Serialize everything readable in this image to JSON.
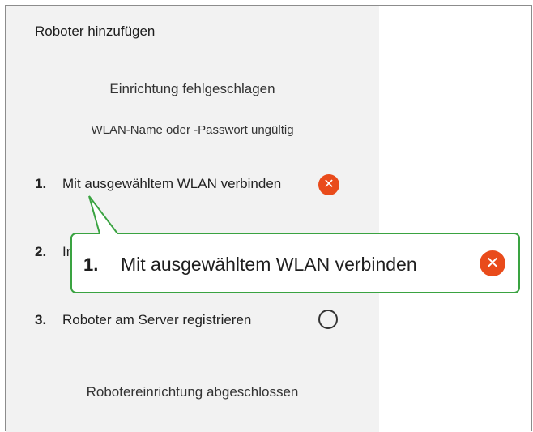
{
  "dialog": {
    "title": "Roboter hinzufügen",
    "status": "Einrichtung fehlgeschlagen",
    "reason": "WLAN-Name oder -Passwort ungültig",
    "completion": "Robotereinrichtung abgeschlossen"
  },
  "steps": [
    {
      "number": "1.",
      "label": "Mit ausgewähltem WLAN verbinden",
      "state": "error",
      "icon": "close-icon"
    },
    {
      "number": "2.",
      "label": "In",
      "state": "hidden-by-callout"
    },
    {
      "number": "3.",
      "label": "Roboter am Server registrieren",
      "state": "pending",
      "icon": "circle-icon"
    }
  ],
  "callout": {
    "number": "1.",
    "label": "Mit ausgewähltem WLAN verbinden",
    "icon": "close-icon"
  },
  "colors": {
    "error": "#e94b1b",
    "callout_border": "#3aa341",
    "panel_bg": "#f2f2f2"
  }
}
